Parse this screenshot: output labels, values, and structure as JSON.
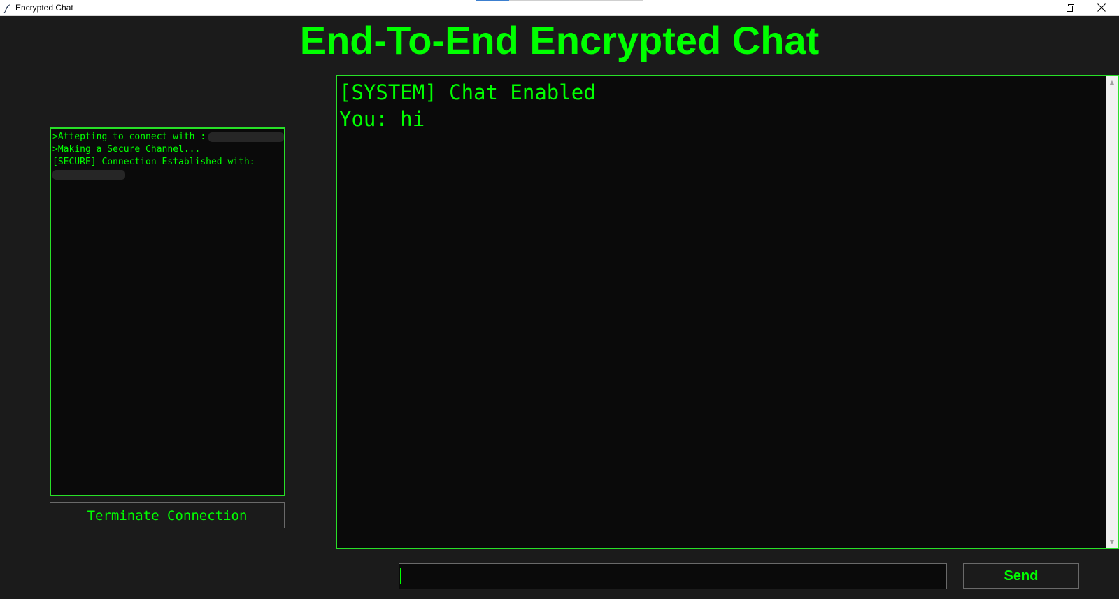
{
  "window": {
    "title": "Encrypted Chat",
    "minimize_icon": "minimize-icon",
    "maximize_icon": "restore-icon",
    "close_icon": "close-icon"
  },
  "colors": {
    "background": "#1b1b1b",
    "accent": "#00ff00",
    "panel_border": "#28e028",
    "panel_background": "#0a0a0a"
  },
  "header": {
    "title": "End-To-End Encrypted Chat"
  },
  "connection_log": {
    "lines": [
      ">Attepting to connect with :",
      ">Making a Secure Channel...",
      "[SECURE] Connection Established with:"
    ]
  },
  "actions": {
    "terminate_label": "Terminate Connection",
    "send_label": "Send"
  },
  "chat": {
    "messages": [
      "[SYSTEM] Chat Enabled",
      "You: hi"
    ]
  },
  "composer": {
    "value": ""
  }
}
